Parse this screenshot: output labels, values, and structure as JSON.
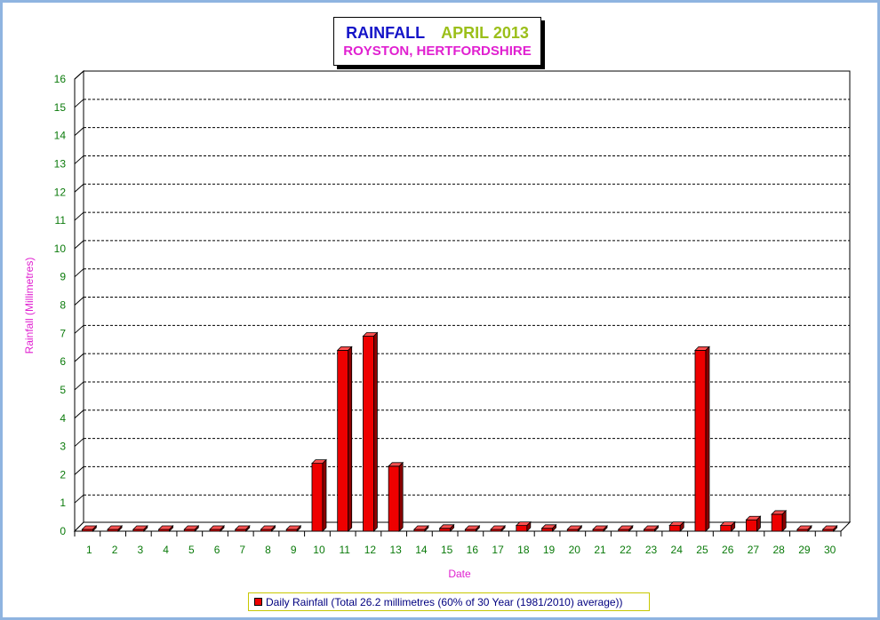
{
  "chart_data": {
    "type": "bar",
    "title": "RAINFALL",
    "period": "APRIL 2013",
    "subtitle": "ROYSTON, HERTFORDSHIRE",
    "xlabel": "Date",
    "ylabel": "Rainfall  (Millimetres)",
    "ylim": [
      0,
      16
    ],
    "yticks": [
      0,
      1,
      2,
      3,
      4,
      5,
      6,
      7,
      8,
      9,
      10,
      11,
      12,
      13,
      14,
      15,
      16
    ],
    "grid": true,
    "legend_position": "bottom-center",
    "categories": [
      "1",
      "2",
      "3",
      "4",
      "5",
      "6",
      "7",
      "8",
      "9",
      "10",
      "11",
      "12",
      "13",
      "14",
      "15",
      "16",
      "17",
      "18",
      "19",
      "20",
      "21",
      "22",
      "23",
      "24",
      "25",
      "26",
      "27",
      "28",
      "29",
      "30"
    ],
    "series": [
      {
        "name": "Daily Rainfall (Total 26.2 millimetres (60% of 30 Year (1981/2010) average))",
        "values": [
          0,
          0,
          0,
          0,
          0,
          0,
          0,
          0,
          0,
          2.4,
          6.4,
          6.9,
          2.3,
          0,
          0.1,
          0,
          0,
          0.2,
          0.1,
          0,
          0,
          0,
          0,
          0.2,
          6.4,
          0.2,
          0.4,
          0.6,
          0,
          0
        ]
      }
    ]
  },
  "colors": {
    "bar_front": "#ee0000",
    "bar_top": "#ff5050",
    "bar_side": "#8c0000",
    "axis_text": "#0a7a0a",
    "label_text": "#e020d0"
  }
}
